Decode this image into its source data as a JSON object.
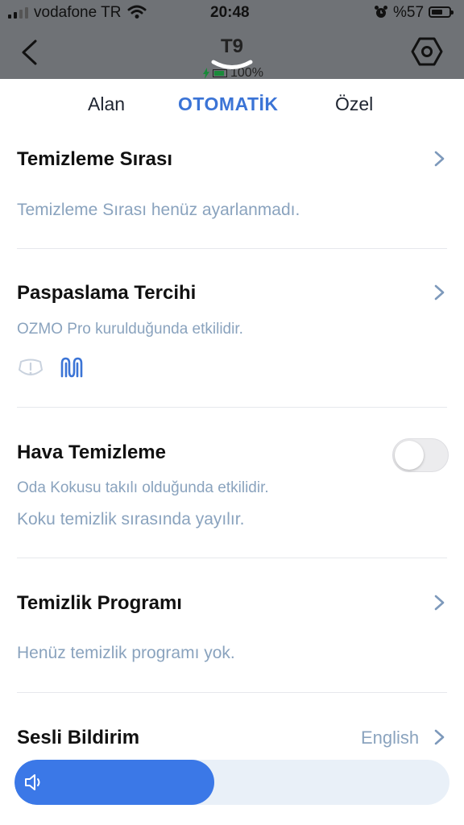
{
  "status_bar": {
    "carrier": "vodafone TR",
    "time": "20:48",
    "battery": "%57"
  },
  "header": {
    "device_name": "T9",
    "device_battery": "100%",
    "icons": [
      "back-chevron-icon",
      "hexagon-settings-icon",
      "charging-bolt-icon"
    ]
  },
  "tabs": [
    {
      "label": "Alan",
      "active": false
    },
    {
      "label": "OTOMATİK",
      "active": true
    },
    {
      "label": "Özel",
      "active": false
    }
  ],
  "sections": {
    "cleaning_order": {
      "title": "Temizleme Sırası",
      "subtitle": "Temizleme Sırası henüz ayarlanmadı."
    },
    "mopping": {
      "title": "Paspaslama Tercihi",
      "subtitle": "OZMO Pro kurulduğunda etkilidir.",
      "icons": [
        "warning-mop-icon",
        "wave-mop-icon"
      ]
    },
    "air_clean": {
      "title": "Hava Temizleme",
      "subtitle1": "Oda Kokusu takılı olduğunda etkilidir.",
      "subtitle2": "Koku temizlik sırasında yayılır.",
      "enabled": false
    },
    "schedule": {
      "title": "Temizlik Programı",
      "subtitle": "Henüz temizlik programı yok."
    },
    "voice": {
      "title": "Sesli Bildirim",
      "language": "English",
      "volume_fraction": 0.46
    }
  },
  "colors": {
    "accent": "#3b74d6",
    "secondary_text": "#8aa3be",
    "header_dim": "#6f7276",
    "volume_fill": "#3b78e7",
    "volume_track": "#e9f0f8"
  }
}
